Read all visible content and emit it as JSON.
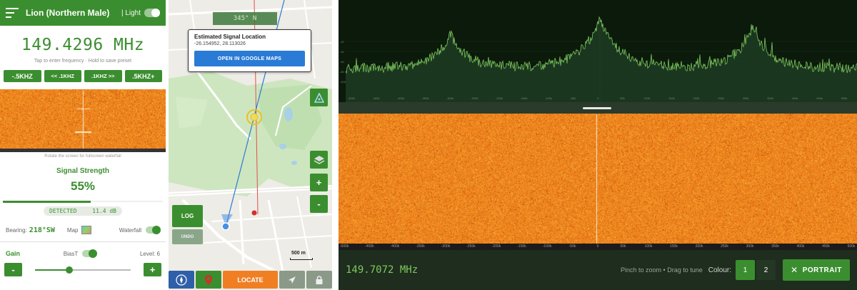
{
  "panel_a": {
    "title": "Lion (Northern Male)",
    "light_label": "| Light",
    "frequency": "149.4296 MHz",
    "frequency_hint": "Tap to enter frequency · Hold to save preset",
    "steps": [
      "-.5KHZ",
      "<< .1KHZ",
      ".1KHZ >>",
      ".5KHZ+"
    ],
    "rotate_hint": "Rotate the screen for fullscreen waterfall",
    "signal_label": "Signal Strength",
    "signal_value": "55%",
    "signal_fraction": 0.55,
    "detected_label": "DETECTED",
    "detected_value": "11.4 dB",
    "bearing_label": "Bearing:",
    "bearing_value": "218°SW",
    "map_label": "Map",
    "waterfall_label": "Waterfall",
    "gain_label": "Gain",
    "biast_label": "BiasT",
    "level_label": "Level: 6",
    "minus_label": "-",
    "plus_label": "+",
    "gain_fraction": 0.36
  },
  "panel_b": {
    "coord_chip": "345° N",
    "popup_title": "Estimated Signal Location",
    "popup_coords": "-26.154952,  28.113026",
    "popup_button": "OPEN IN GOOGLE MAPS",
    "log_label": "LOG",
    "undo_label": "UNDO",
    "zoom_in": "+",
    "zoom_out": "-",
    "scale_label": "500 m",
    "locate_label": "LOCATE"
  },
  "panel_c": {
    "frequency": "149.7072 MHz",
    "hint": "Pinch to zoom  •  Drag to tune",
    "colour_label": "Colour:",
    "colour_options": [
      "1",
      "2"
    ],
    "portrait_label": "PORTRAIT",
    "axis_ticks": [
      "-500k",
      "-450k",
      "-400k",
      "-350k",
      "-300k",
      "-250k",
      "-200k",
      "-150k",
      "-100k",
      "-50k",
      "0",
      "50k",
      "100k",
      "150k",
      "200k",
      "250k",
      "300k",
      "350k",
      "400k",
      "450k",
      "500k"
    ],
    "db_ticks": [
      "-20",
      "-40",
      "-60",
      "-80",
      "-100"
    ]
  },
  "colors": {
    "brand_green": "#3b8e2f",
    "spectrum_green": "#7ec85e",
    "locate_orange": "#f07f24",
    "maps_blue": "#2a7bd6",
    "waterfall_orange": "#e9821d"
  }
}
